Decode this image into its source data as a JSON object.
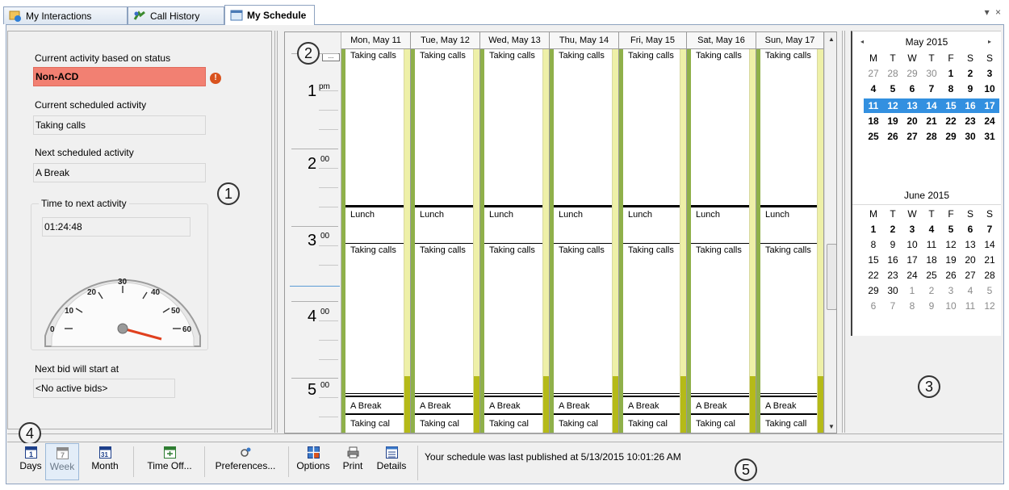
{
  "tabs": [
    {
      "label": "My Interactions",
      "icon": "interactions-icon",
      "active": false
    },
    {
      "label": "Call History",
      "icon": "call-history-icon",
      "active": false
    },
    {
      "label": "My Schedule",
      "icon": "schedule-icon",
      "active": true
    }
  ],
  "window_controls": {
    "dropdown": "▾",
    "close": "×"
  },
  "status_panel": {
    "current_activity_label": "Current activity based on status",
    "current_activity_value": "Non-ACD",
    "current_scheduled_label": "Current scheduled activity",
    "current_scheduled_value": "Taking calls",
    "next_scheduled_label": "Next scheduled activity",
    "next_scheduled_value": "A Break",
    "time_to_next_label": "Time to next activity",
    "time_to_next_value": "01:24:48",
    "gauge_ticks": [
      "0",
      "10",
      "20",
      "30",
      "40",
      "50",
      "60"
    ],
    "next_bid_label": "Next bid will start at",
    "next_bid_value": "<No active bids>"
  },
  "callouts": [
    "1",
    "2",
    "3",
    "4",
    "5"
  ],
  "schedule": {
    "expand_label": "...",
    "hours": [
      {
        "hour": "1",
        "sup": "pm"
      },
      {
        "hour": "2",
        "sup": "00"
      },
      {
        "hour": "3",
        "sup": "00"
      },
      {
        "hour": "4",
        "sup": "00"
      },
      {
        "hour": "5",
        "sup": "00"
      }
    ],
    "days": [
      {
        "header": "Mon, May 11",
        "blocks": [
          "Taking calls",
          "Lunch",
          "Taking calls",
          "A Break",
          "Taking cal"
        ]
      },
      {
        "header": "Tue, May 12",
        "blocks": [
          "Taking calls",
          "Lunch",
          "Taking calls",
          "A Break",
          "Taking cal"
        ]
      },
      {
        "header": "Wed, May 13",
        "blocks": [
          "Taking calls",
          "Lunch",
          "Taking calls",
          "A Break",
          "Taking cal"
        ]
      },
      {
        "header": "Thu, May 14",
        "blocks": [
          "Taking calls",
          "Lunch",
          "Taking calls",
          "A Break",
          "Taking cal"
        ]
      },
      {
        "header": "Fri, May 15",
        "blocks": [
          "Taking calls",
          "Lunch",
          "Taking calls",
          "A Break",
          "Taking cal"
        ]
      },
      {
        "header": "Sat, May 16",
        "blocks": [
          "Taking calls",
          "Lunch",
          "Taking calls",
          "A Break",
          "Taking cal"
        ]
      },
      {
        "header": "Sun, May 17",
        "blocks": [
          "Taking calls",
          "Lunch",
          "Taking calls",
          "A Break",
          "Taking call"
        ]
      }
    ]
  },
  "calendar": {
    "nav_prev": "◂",
    "nav_next": "▸",
    "months": [
      {
        "title": "May 2015",
        "dow": [
          "M",
          "T",
          "W",
          "T",
          "F",
          "S",
          "S"
        ],
        "weeks": [
          [
            "27",
            "28",
            "29",
            "30",
            "1",
            "2",
            "3"
          ],
          [
            "4",
            "5",
            "6",
            "7",
            "8",
            "9",
            "10"
          ],
          [
            "11",
            "12",
            "13",
            "14",
            "15",
            "16",
            "17"
          ],
          [
            "18",
            "19",
            "20",
            "21",
            "22",
            "23",
            "24"
          ],
          [
            "25",
            "26",
            "27",
            "28",
            "29",
            "30",
            "31"
          ]
        ]
      },
      {
        "title": "June 2015",
        "dow": [
          "M",
          "T",
          "W",
          "T",
          "F",
          "S",
          "S"
        ],
        "weeks": [
          [
            "1",
            "2",
            "3",
            "4",
            "5",
            "6",
            "7"
          ],
          [
            "8",
            "9",
            "10",
            "11",
            "12",
            "13",
            "14"
          ],
          [
            "15",
            "16",
            "17",
            "18",
            "19",
            "20",
            "21"
          ],
          [
            "22",
            "23",
            "24",
            "25",
            "26",
            "27",
            "28"
          ],
          [
            "29",
            "30",
            "1",
            "2",
            "3",
            "4",
            "5"
          ],
          [
            "6",
            "7",
            "8",
            "9",
            "10",
            "11",
            "12"
          ]
        ]
      }
    ],
    "selected_week": "11–17 May 2015"
  },
  "toolbar": {
    "days_label": "Days",
    "days_icon_text": "1",
    "week_label": "Week",
    "week_icon_text": "7",
    "month_label": "Month",
    "month_icon_text": "31",
    "timeoff_label": "Time Off...",
    "preferences_label": "Preferences...",
    "options_label": "Options",
    "print_label": "Print",
    "details_label": "Details",
    "status_message": "Your schedule was last published at 5/13/2015 10:01:26 AM"
  },
  "colors": {
    "alert_bg": "#f28072",
    "lunch": "#c0605a",
    "break": "#6fa0d0",
    "available": "#8fb04a",
    "selected_week": "#3390e0"
  }
}
